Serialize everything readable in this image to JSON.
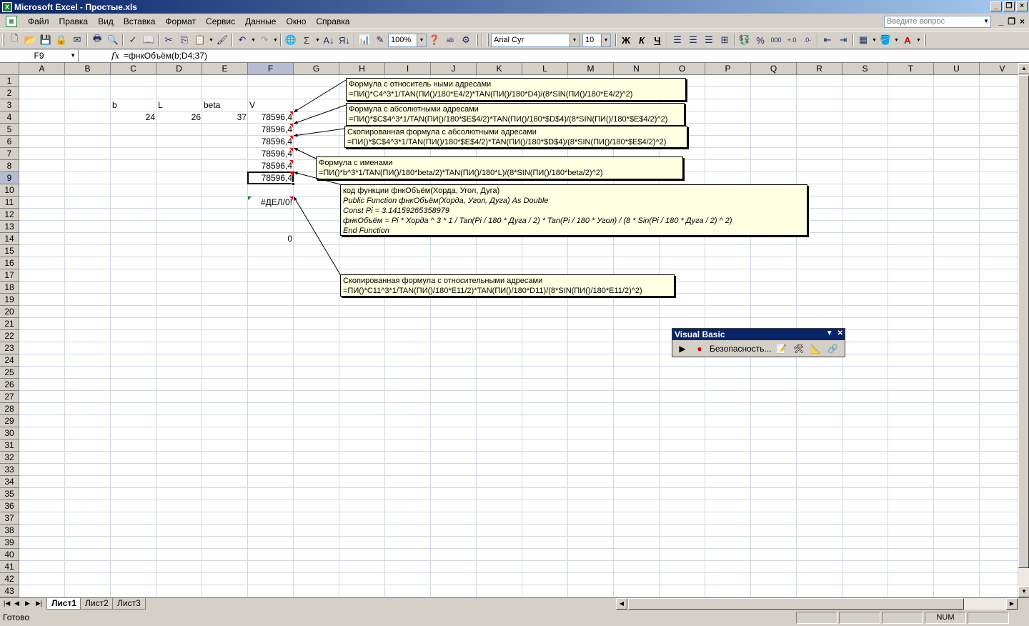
{
  "window": {
    "title": "Microsoft Excel - Простые.xls"
  },
  "menu": {
    "items": [
      "Файл",
      "Правка",
      "Вид",
      "Вставка",
      "Формат",
      "Сервис",
      "Данные",
      "Окно",
      "Справка"
    ],
    "question_placeholder": "Введите вопрос"
  },
  "toolbar": {
    "zoom": "100%",
    "font_name": "Arial Cyr",
    "font_size": "10",
    "bold": "Ж",
    "italic": "К",
    "underline": "Ч",
    "percent": "%",
    "thousands": "000",
    "sigma": "Σ"
  },
  "formula_bar": {
    "name_box": "F9",
    "fx": "fx",
    "formula": "=фнкОбъём(b;D4;37)"
  },
  "columns": [
    "A",
    "B",
    "C",
    "D",
    "E",
    "F",
    "G",
    "H",
    "I",
    "J",
    "K",
    "L",
    "M",
    "N",
    "O",
    "P",
    "Q",
    "R",
    "S",
    "T",
    "U",
    "V"
  ],
  "rows": [
    "1",
    "2",
    "3",
    "4",
    "5",
    "6",
    "7",
    "8",
    "9",
    "10",
    "11",
    "12",
    "13",
    "14",
    "15",
    "16",
    "17",
    "18",
    "19",
    "20",
    "21",
    "22",
    "23",
    "24",
    "25",
    "26",
    "27",
    "28",
    "29",
    "30",
    "31",
    "32",
    "33",
    "34",
    "35",
    "36",
    "37",
    "38",
    "39",
    "40",
    "41",
    "42",
    "43"
  ],
  "cells": {
    "C3": "b",
    "D3": "L",
    "E3": "beta",
    "F3": "V",
    "C4": "24",
    "D4": "26",
    "E4": "37",
    "F4": "78596,4",
    "F5": "78596,4",
    "F6": "78596,4",
    "F7": "78596,4",
    "F8": "78596,4",
    "F9": "78596,4",
    "F11": "#ДЕЛ/0!",
    "F14": "0"
  },
  "comments": {
    "c1": {
      "title": "Формула с относитель ными адресами",
      "text": "=ПИ()*C4^3*1/TAN(ПИ()/180*E4/2)*TAN(ПИ()/180*D4)/(8*SIN(ПИ()/180*E4/2)^2)"
    },
    "c2": {
      "title": "Формула с абсолютными адресами",
      "text": "=ПИ()*$C$4^3*1/TAN(ПИ()/180*$E$4/2)*TAN(ПИ()/180*$D$4)/(8*SIN(ПИ()/180*$E$4/2)^2)"
    },
    "c3": {
      "title": "Скопированная формула с абсолютными адресами",
      "text": "=ПИ()*$C$4^3*1/TAN(ПИ()/180*$E$4/2)*TAN(ПИ()/180*$D$4)/(8*SIN(ПИ()/180*$E$4/2)^2)"
    },
    "c4": {
      "title": "Формула с именами",
      "text": "=ПИ()*b^3*1/TAN(ПИ()/180*beta/2)*TAN(ПИ()/180*L)/(8*SIN(ПИ()/180*beta/2)^2)"
    },
    "c5": {
      "title": "код функции фнкОбъём(Хорда, Угол, Дуга)",
      "line1": "Public Function фнкОбъём(Хорда, Угол, Дуга) As Double",
      "line2": "Const Pi = 3.14159265358979",
      "line3": "фнкОбъём = Pi * Хорда ^ 3 * 1 / Tan(Pi / 180 * Дуга / 2) * Tan(Pi / 180 * Угол) / (8 * Sin(Pi / 180 * Дуга / 2) ^ 2)",
      "line4": "End Function"
    },
    "c6": {
      "title": "Скопированная формула с относительными адресами",
      "text": "=ПИ()*C11^3*1/TAN(ПИ()/180*E11/2)*TAN(ПИ()/180*D11)/(8*SIN(ПИ()/180*E11/2)^2)"
    }
  },
  "sheets": [
    "Лист1",
    "Лист2",
    "Лист3"
  ],
  "status": {
    "text": "Готово",
    "num": "NUM"
  },
  "vb_toolbar": {
    "title": "Visual Basic",
    "security": "Безопасность..."
  }
}
